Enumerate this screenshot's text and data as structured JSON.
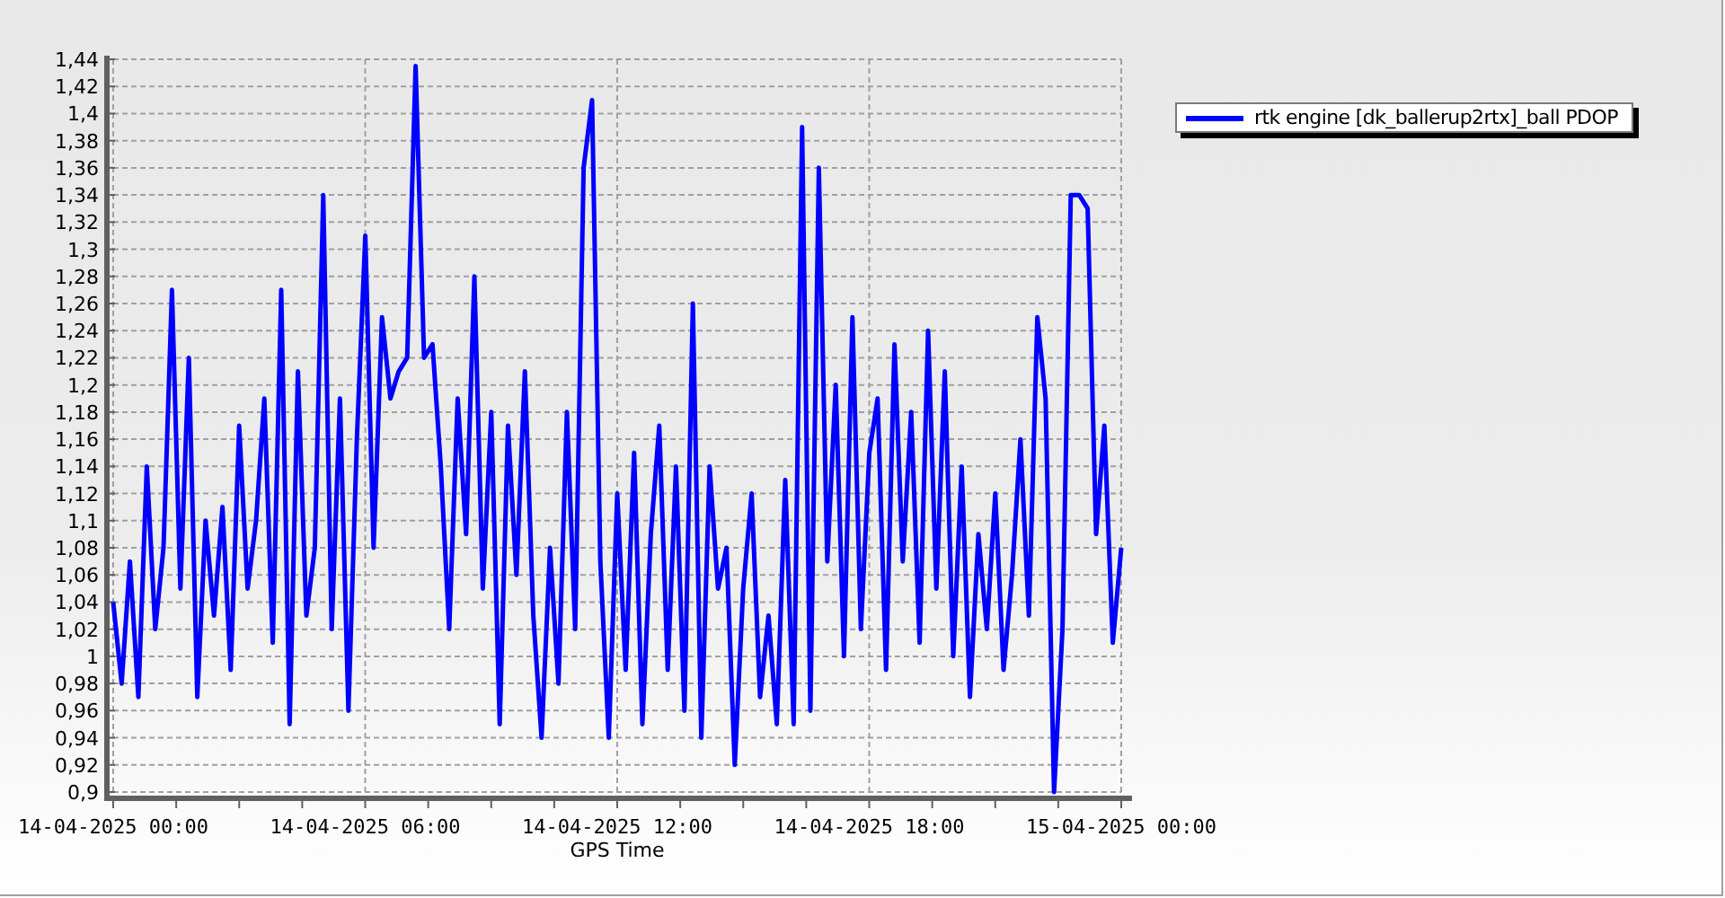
{
  "chart_data": {
    "type": "line",
    "xlabel": "GPS Time",
    "categories": [
      "14-04-2025 00:00",
      null,
      null,
      null,
      null,
      null,
      null,
      null,
      null,
      null,
      null,
      null,
      null,
      null,
      null,
      null,
      null,
      null,
      null,
      null,
      null,
      null,
      null,
      null,
      null,
      null,
      null,
      null,
      null,
      null,
      "14-04-2025 06:00",
      null,
      null,
      null,
      null,
      null,
      null,
      null,
      null,
      null,
      null,
      null,
      null,
      null,
      null,
      null,
      null,
      null,
      null,
      null,
      null,
      null,
      null,
      null,
      null,
      null,
      null,
      null,
      null,
      null,
      "14-04-2025 12:00",
      null,
      null,
      null,
      null,
      null,
      null,
      null,
      null,
      null,
      null,
      null,
      null,
      null,
      null,
      null,
      null,
      null,
      null,
      null,
      null,
      null,
      null,
      null,
      null,
      null,
      null,
      null,
      null,
      null,
      "14-04-2025 18:00",
      null,
      null,
      null,
      null,
      null,
      null,
      null,
      null,
      null,
      null,
      null,
      null,
      null,
      null,
      null,
      null,
      null,
      null,
      null,
      null,
      null,
      null,
      null,
      null,
      null,
      null,
      null,
      null,
      null,
      "15-04-2025 00:00"
    ],
    "series": [
      {
        "name": "rtk engine [dk_ballerup2rtx]_ball PDOP",
        "color": "#0000ff",
        "values": [
          1.04,
          0.98,
          1.07,
          0.97,
          1.14,
          1.02,
          1.08,
          1.27,
          1.05,
          1.22,
          0.97,
          1.1,
          1.03,
          1.11,
          0.99,
          1.17,
          1.05,
          1.1,
          1.19,
          1.01,
          1.27,
          0.95,
          1.21,
          1.03,
          1.08,
          1.34,
          1.02,
          1.19,
          0.96,
          1.16,
          1.31,
          1.08,
          1.25,
          1.19,
          1.21,
          1.22,
          1.435,
          1.22,
          1.23,
          1.14,
          1.02,
          1.19,
          1.09,
          1.28,
          1.05,
          1.18,
          0.95,
          1.17,
          1.06,
          1.21,
          1.03,
          0.94,
          1.08,
          0.98,
          1.18,
          1.02,
          1.36,
          1.41,
          1.07,
          0.94,
          1.12,
          0.99,
          1.15,
          0.95,
          1.09,
          1.17,
          0.99,
          1.14,
          0.96,
          1.26,
          0.94,
          1.14,
          1.05,
          1.08,
          0.92,
          1.05,
          1.12,
          0.97,
          1.03,
          0.95,
          1.13,
          0.95,
          1.39,
          0.96,
          1.36,
          1.07,
          1.2,
          1.0,
          1.25,
          1.02,
          1.15,
          1.19,
          0.99,
          1.23,
          1.07,
          1.18,
          1.01,
          1.24,
          1.05,
          1.21,
          1.0,
          1.14,
          0.97,
          1.09,
          1.02,
          1.12,
          0.99,
          1.06,
          1.16,
          1.03,
          1.25,
          1.19,
          0.9,
          1.02,
          1.34,
          1.34,
          1.33,
          1.09,
          1.17,
          1.01,
          1.08
        ]
      }
    ],
    "ylim": [
      0.9,
      1.44
    ],
    "grid": true,
    "yticks": [
      {
        "value": 0.9,
        "label": "0,9"
      },
      {
        "value": 0.92,
        "label": "0,92"
      },
      {
        "value": 0.94,
        "label": "0,94"
      },
      {
        "value": 0.96,
        "label": "0,96"
      },
      {
        "value": 0.98,
        "label": "0,98"
      },
      {
        "value": 1,
        "label": "1"
      },
      {
        "value": 1.02,
        "label": "1,02"
      },
      {
        "value": 1.04,
        "label": "1,04"
      },
      {
        "value": 1.06,
        "label": "1,06"
      },
      {
        "value": 1.08,
        "label": "1,08"
      },
      {
        "value": 1.1,
        "label": "1,1"
      },
      {
        "value": 1.12,
        "label": "1,12"
      },
      {
        "value": 1.14,
        "label": "1,14"
      },
      {
        "value": 1.16,
        "label": "1,16"
      },
      {
        "value": 1.18,
        "label": "1,18"
      },
      {
        "value": 1.2,
        "label": "1,2"
      },
      {
        "value": 1.22,
        "label": "1,22"
      },
      {
        "value": 1.24,
        "label": "1,24"
      },
      {
        "value": 1.26,
        "label": "1,26"
      },
      {
        "value": 1.28,
        "label": "1,28"
      },
      {
        "value": 1.3,
        "label": "1,3"
      },
      {
        "value": 1.32,
        "label": "1,32"
      },
      {
        "value": 1.34,
        "label": "1,34"
      },
      {
        "value": 1.36,
        "label": "1,36"
      },
      {
        "value": 1.38,
        "label": "1,38"
      },
      {
        "value": 1.4,
        "label": "1,4"
      },
      {
        "value": 1.42,
        "label": "1,42"
      },
      {
        "value": 1.44,
        "label": "1,44"
      }
    ]
  }
}
